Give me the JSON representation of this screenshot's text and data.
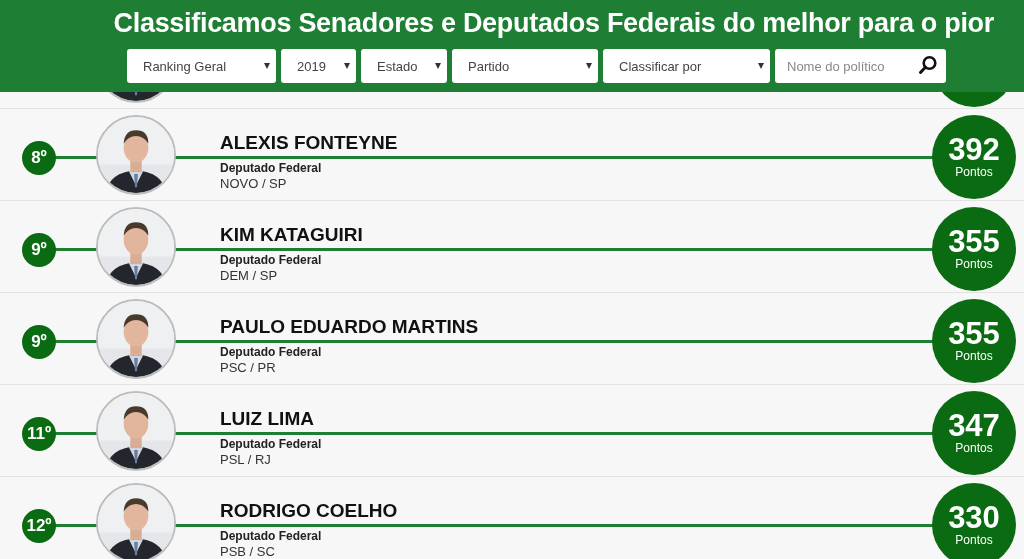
{
  "header": {
    "title": "Classificamos Senadores e Deputados Federais do melhor para o pior"
  },
  "filters": [
    {
      "label": "Ranking Geral",
      "kind": "select"
    },
    {
      "label": "2019",
      "kind": "select"
    },
    {
      "label": "Estado",
      "kind": "select"
    },
    {
      "label": "Partido",
      "kind": "select"
    },
    {
      "label": "Classificar por",
      "kind": "select"
    }
  ],
  "search": {
    "placeholder": "Nome do político"
  },
  "rows": [
    {
      "kind": "partial"
    },
    {
      "kind": "entry",
      "rank": "8º",
      "name": "ALEXIS FONTEYNE",
      "role": "Deputado Federal",
      "party": "NOVO / SP",
      "score": "392",
      "unit": "Pontos"
    },
    {
      "kind": "entry",
      "rank": "9º",
      "name": "KIM KATAGUIRI",
      "role": "Deputado Federal",
      "party": "DEM / SP",
      "score": "355",
      "unit": "Pontos"
    },
    {
      "kind": "entry",
      "rank": "9º",
      "name": "PAULO EDUARDO MARTINS",
      "role": "Deputado Federal",
      "party": "PSC / PR",
      "score": "355",
      "unit": "Pontos"
    },
    {
      "kind": "entry",
      "rank": "11º",
      "name": "LUIZ LIMA",
      "role": "Deputado Federal",
      "party": "PSL / RJ",
      "score": "347",
      "unit": "Pontos"
    },
    {
      "kind": "entry",
      "rank": "12º",
      "name": "RODRIGO COELHO",
      "role": "Deputado Federal",
      "party": "PSB / SC",
      "score": "330",
      "unit": "Pontos"
    }
  ]
}
